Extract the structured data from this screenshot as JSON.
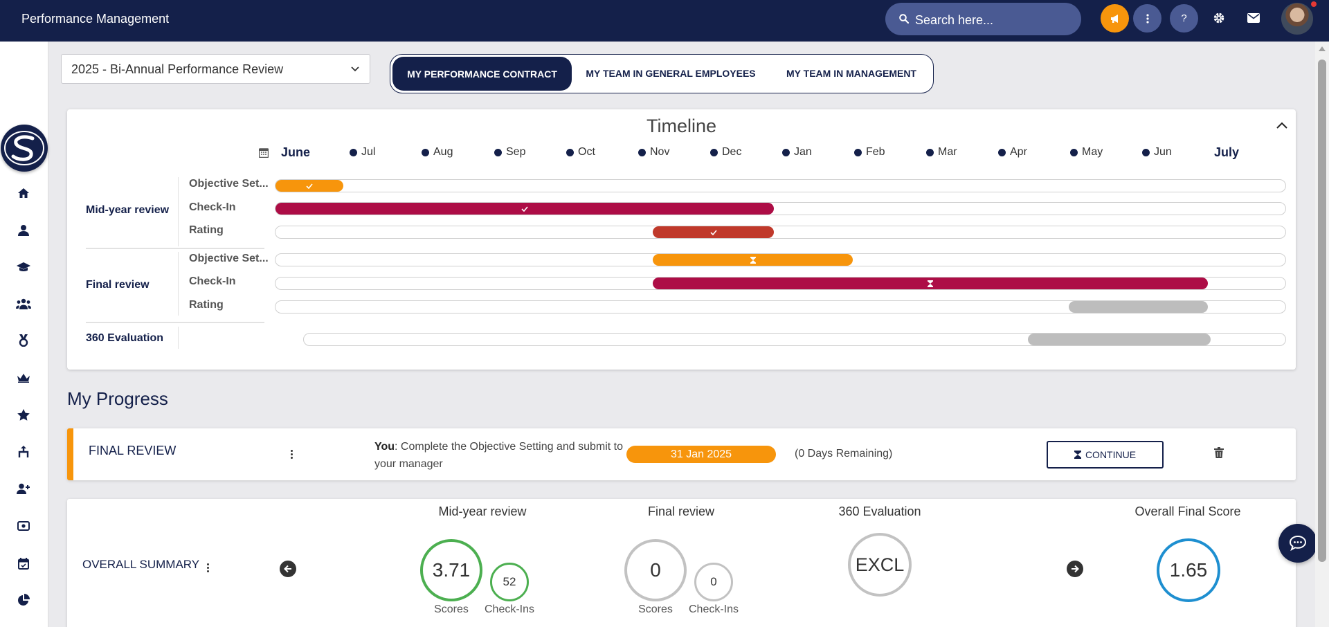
{
  "header": {
    "app_title": "Performance Management",
    "search_placeholder": "Search here...",
    "icons": [
      "megaphone-icon",
      "more-vertical-icon",
      "help-icon",
      "gear-icon",
      "mail-icon"
    ],
    "colors": {
      "navy": "#14204a",
      "accent_orange": "#f7950c"
    }
  },
  "sidebar": {
    "icons": [
      "home-icon",
      "user-icon",
      "graduation-cap-icon",
      "team-icon",
      "medal-icon",
      "crown-icon",
      "star-icon",
      "org-chart-icon",
      "user-plus-icon",
      "money-icon",
      "calendar-icon",
      "pie-chart-icon"
    ]
  },
  "controls": {
    "review_cycle": "2025 - Bi-Annual Performance Review",
    "tabs": [
      {
        "label": "MY PERFORMANCE CONTRACT",
        "active": true
      },
      {
        "label": "MY TEAM IN GENERAL EMPLOYEES",
        "active": false
      },
      {
        "label": "MY TEAM IN MANAGEMENT",
        "active": false
      }
    ]
  },
  "timeline": {
    "title": "Timeline",
    "start_label": "June",
    "months": [
      "Jul",
      "Aug",
      "Sep",
      "Oct",
      "Nov",
      "Dec",
      "Jan",
      "Feb",
      "Mar",
      "Apr",
      "May",
      "Jun"
    ],
    "end_label": "July",
    "groups": [
      {
        "label": "Mid-year review",
        "rows": [
          {
            "label": "Objective Set...",
            "status": "complete",
            "color": "orange"
          },
          {
            "label": "Check-In",
            "status": "complete",
            "color": "crimson"
          },
          {
            "label": "Rating",
            "status": "complete",
            "color": "red"
          }
        ]
      },
      {
        "label": "Final review",
        "rows": [
          {
            "label": "Objective Set...",
            "status": "in-progress",
            "color": "orange"
          },
          {
            "label": "Check-In",
            "status": "in-progress",
            "color": "crimson"
          },
          {
            "label": "Rating",
            "status": "upcoming",
            "color": "grey"
          }
        ]
      },
      {
        "label": "360 Evaluation",
        "rows": [
          {
            "label": "",
            "status": "upcoming",
            "color": "grey"
          }
        ]
      }
    ]
  },
  "progress": {
    "section_title": "My Progress",
    "final_review": {
      "title": "FINAL REVIEW",
      "actor": "You",
      "task": ": Complete the Objective Setting and submit to your manager",
      "due_date": "31 Jan 2025",
      "days_remaining": "(0 Days Remaining)",
      "action_label": "CONTINUE"
    }
  },
  "summary": {
    "title": "OVERALL SUMMARY",
    "midyear": {
      "heading": "Mid-year review",
      "score": "3.71",
      "checkins": "52",
      "score_label": "Scores",
      "checkins_label": "Check-Ins"
    },
    "final": {
      "heading": "Final review",
      "score": "0",
      "checkins": "0",
      "score_label": "Scores",
      "checkins_label": "Check-Ins"
    },
    "evaluation360": {
      "heading": "360 Evaluation",
      "value": "EXCL"
    },
    "overall": {
      "heading": "Overall Final Score",
      "score": "1.65"
    }
  }
}
